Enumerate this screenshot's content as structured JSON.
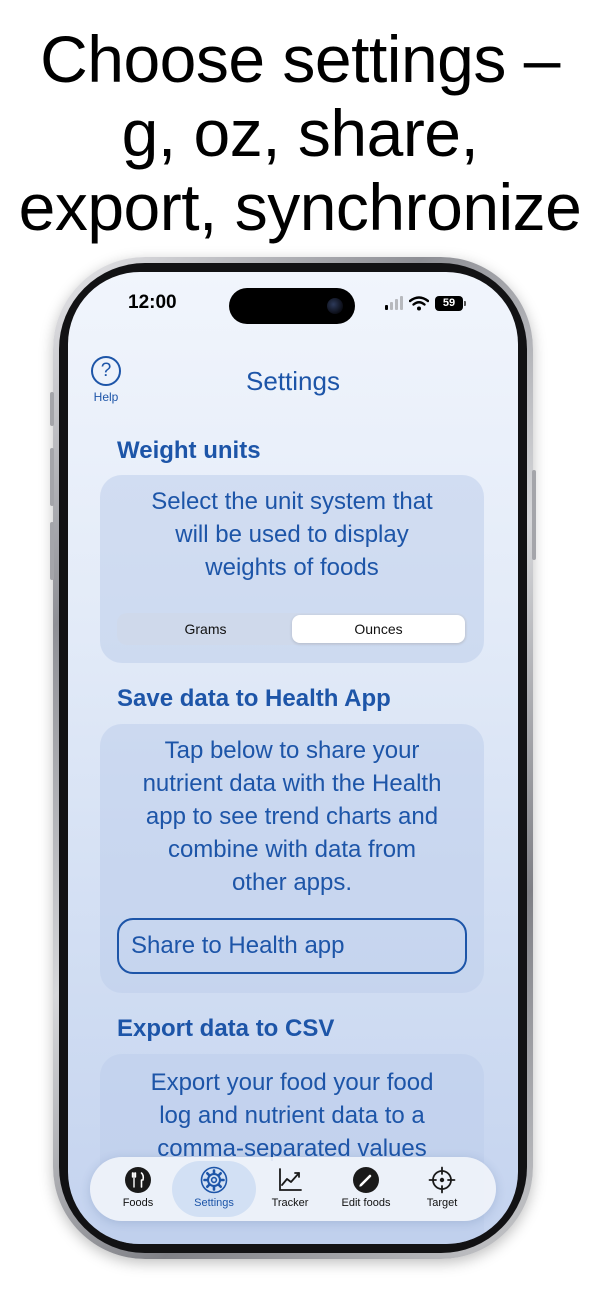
{
  "headline": {
    "lines": [
      "Choose settings –",
      "g, oz, share,",
      "export, synchronize"
    ]
  },
  "status_bar": {
    "time": "12:00",
    "battery": "59"
  },
  "nav": {
    "help_label": "Help",
    "help_glyph": "?",
    "title": "Settings"
  },
  "sections": {
    "weight_units": {
      "title": "Weight units",
      "lines": [
        "Select the unit system that",
        "will be used to display",
        "weights of foods"
      ],
      "options": [
        "Grams",
        "Ounces"
      ],
      "selected": "Ounces"
    },
    "health": {
      "title": "Save data to Health App",
      "lines": [
        "Tap below to share your",
        "nutrient data with the Health",
        "app to see trend charts and",
        "combine with data from",
        "other apps."
      ],
      "button_label": "Share to Health app"
    },
    "export": {
      "title": "Export data to CSV",
      "lines": [
        "Export your food your food",
        "log and nutrient data to a",
        "comma-separated values"
      ]
    }
  },
  "tabbar": {
    "active": "Settings",
    "items": [
      {
        "label": "Foods",
        "icon": "fork-knife-icon"
      },
      {
        "label": "Settings",
        "icon": "gear-icon"
      },
      {
        "label": "Tracker",
        "icon": "chart-icon"
      },
      {
        "label": "Edit foods",
        "icon": "pencil-icon"
      },
      {
        "label": "Target",
        "icon": "target-icon"
      }
    ]
  },
  "colors": {
    "accent": "#1d55a8",
    "tab_active_bg": "#d2e0f4"
  }
}
